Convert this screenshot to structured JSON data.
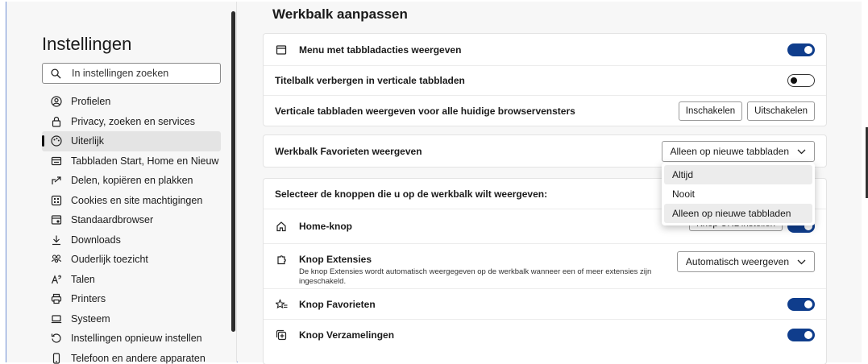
{
  "sidebar": {
    "title": "Instellingen",
    "search_placeholder": "In instellingen zoeken",
    "items": [
      {
        "label": "Profielen",
        "icon": "profile-icon"
      },
      {
        "label": "Privacy, zoeken en services",
        "icon": "lock-icon"
      },
      {
        "label": "Uiterlijk",
        "icon": "appearance-icon",
        "active": true
      },
      {
        "label": "Tabbladen Start, Home en Nieuw",
        "icon": "tabs-icon"
      },
      {
        "label": "Delen, kopiëren en plakken",
        "icon": "share-icon"
      },
      {
        "label": "Cookies en site machtigingen",
        "icon": "cookies-icon"
      },
      {
        "label": "Standaardbrowser",
        "icon": "browser-icon"
      },
      {
        "label": "Downloads",
        "icon": "download-icon"
      },
      {
        "label": "Ouderlijk toezicht",
        "icon": "family-icon"
      },
      {
        "label": "Talen",
        "icon": "language-icon"
      },
      {
        "label": "Printers",
        "icon": "printer-icon"
      },
      {
        "label": "Systeem",
        "icon": "system-icon"
      },
      {
        "label": "Instellingen opnieuw instellen",
        "icon": "reset-icon"
      },
      {
        "label": "Telefoon en andere apparaten",
        "icon": "phone-icon"
      }
    ]
  },
  "main": {
    "section_title": "Werkbalk aanpassen",
    "tab_actions_menu": {
      "label": "Menu met tabbladacties weergeven",
      "toggle": "on"
    },
    "hide_titlebar": {
      "label": "Titelbalk verbergen in verticale tabbladen",
      "toggle": "off"
    },
    "vertical_tabs": {
      "label": "Verticale tabbladen weergeven voor alle huidige browservensters",
      "enable": "Inschakelen",
      "disable": "Uitschakelen"
    },
    "favorites_bar": {
      "label": "Werkbalk Favorieten weergeven",
      "value": "Alleen op nieuwe tabbladen"
    },
    "dropdown_options": [
      "Altijd",
      "Nooit",
      "Alleen op nieuwe tabbladen"
    ],
    "select_buttons_heading": "Selecteer de knoppen die u op de werkbalk wilt weergeven:",
    "home_button": {
      "label": "Home-knop",
      "button_partial": "Knop URL instellen"
    },
    "extensions_button": {
      "label": "Knop Extensies",
      "description": "De knop Extensies wordt automatisch weergegeven op de werkbalk wanneer een of meer extensies zijn ingeschakeld.",
      "value": "Automatisch weergeven"
    },
    "favorites_button": {
      "label": "Knop Favorieten",
      "toggle": "on"
    },
    "collections_button": {
      "label": "Knop Verzamelingen",
      "toggle": "on"
    }
  },
  "colors": {
    "accent": "#0f3d8c",
    "frame_border": "#6f8fd3"
  }
}
